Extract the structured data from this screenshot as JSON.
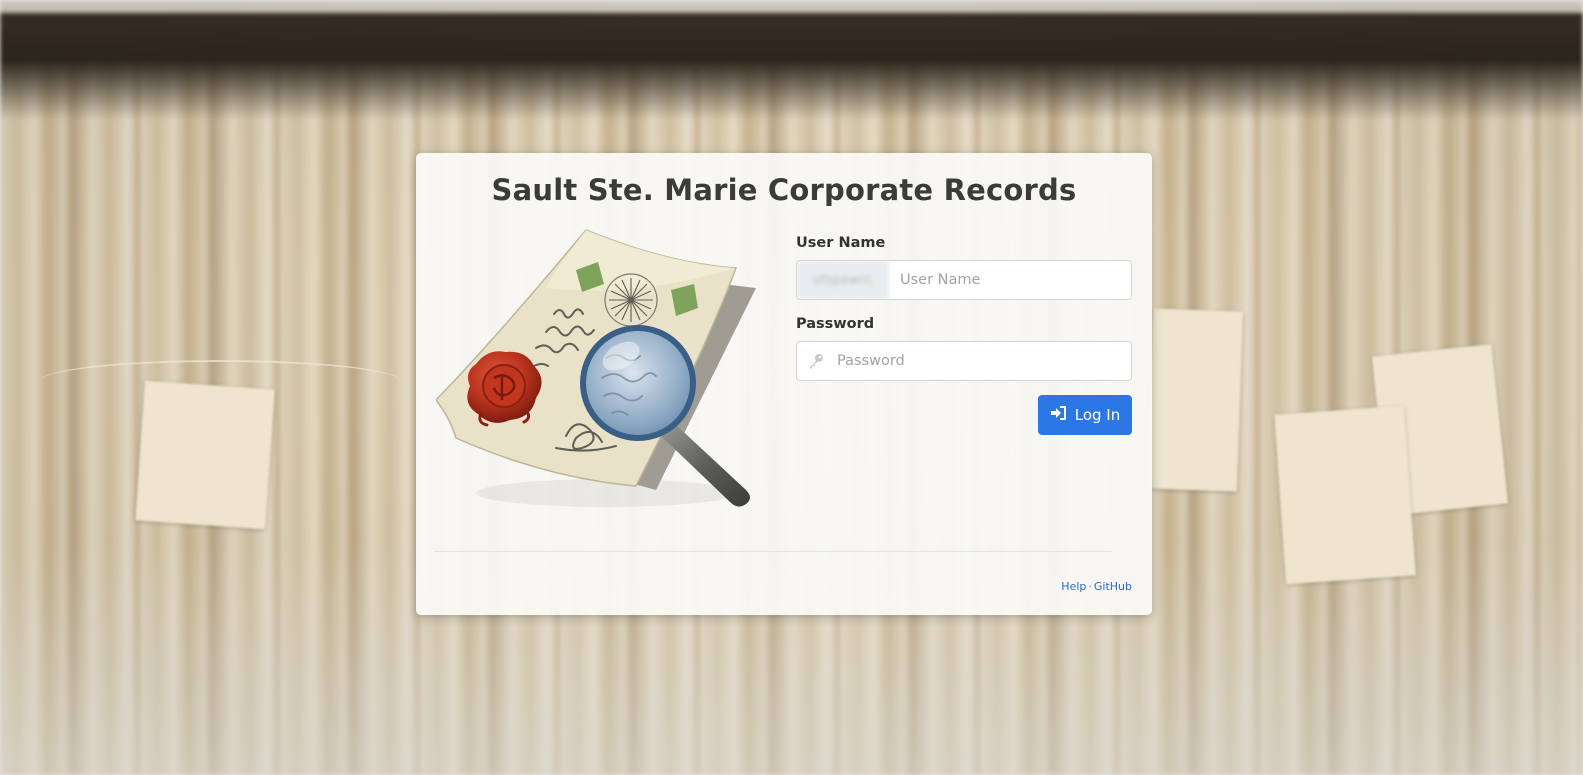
{
  "page": {
    "title": "Sault Ste. Marie Corporate Records"
  },
  "form": {
    "username_label": "User Name",
    "username_prefix": "ofspawn\\",
    "username_placeholder": "User Name",
    "username_value": "",
    "password_label": "Password",
    "password_placeholder": "Password",
    "password_value": "",
    "login_label": "Log In",
    "login_icon": "sign-in-icon",
    "password_icon": "key-icon"
  },
  "footer": {
    "help_label": "Help",
    "separator": "·",
    "github_label": "GitHub"
  },
  "colors": {
    "accent": "#2b78e4",
    "link": "#2b6cc4",
    "title": "#3b3b3b"
  },
  "illustration": {
    "icon": "parchment-seal-magnifier-icon"
  }
}
